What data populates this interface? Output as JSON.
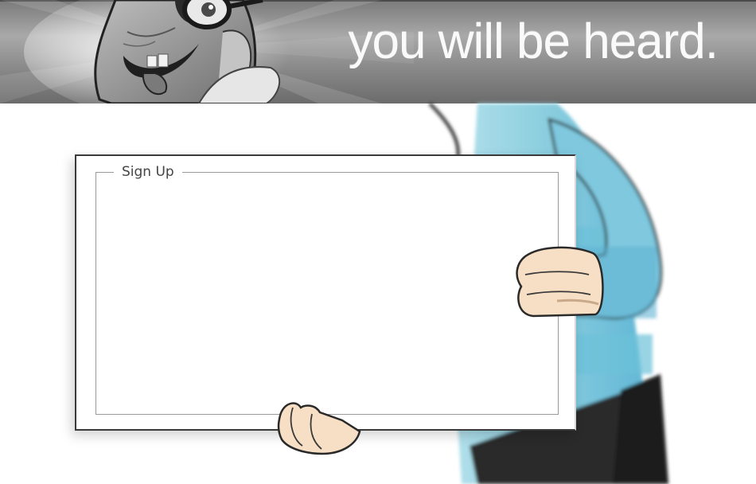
{
  "header": {
    "tagline": "you will be heard.",
    "mascot_icon": "cartoon-face-icon"
  },
  "signup": {
    "legend": "Sign Up"
  },
  "colors": {
    "banner_dark": "#5e5e5e",
    "banner_light": "#d0d0d0",
    "sweater_blue": "#7fc6dc",
    "sweater_dark": "#4ea4c8",
    "skin": "#f6dfc4",
    "pants": "#2c2c2c"
  }
}
